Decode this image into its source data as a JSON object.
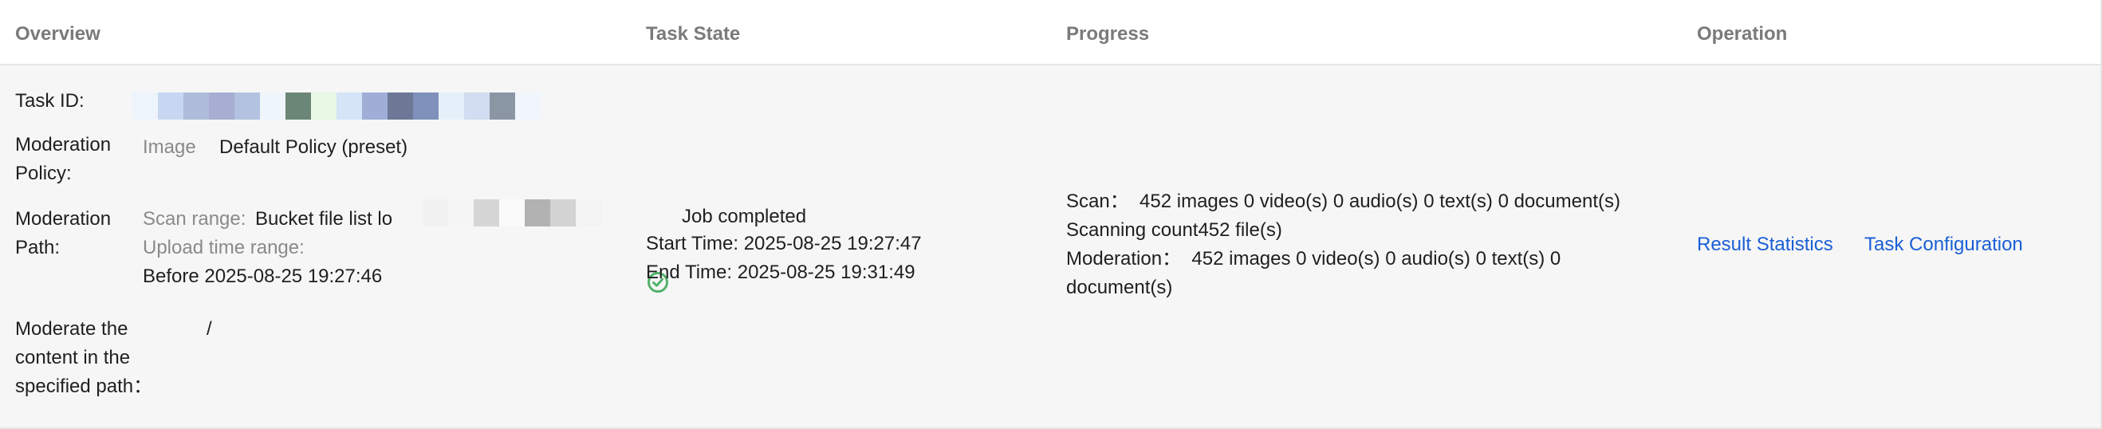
{
  "table": {
    "headers": {
      "overview": "Overview",
      "task_state": "Task State",
      "progress": "Progress",
      "operation": "Operation"
    },
    "row": {
      "overview": {
        "task_id_label": "Task ID:",
        "moderation_policy_label_line1": "Moderation",
        "moderation_policy_label_line2": "Policy:",
        "policy_type": "Image",
        "policy_name": "Default Policy (preset)",
        "moderation_path_label_line1": "Moderation",
        "moderation_path_label_line2": "Path:",
        "scan_range_label": "Scan range:",
        "scan_range_value": "Bucket file list lo",
        "upload_time_range_label": "Upload time range:",
        "upload_time_range_value": "Before 2025-08-25 19:27:46",
        "specified_path_label_line1": "Moderate the",
        "specified_path_label_line2": "content in the",
        "specified_path_label_line3": "specified path：",
        "specified_path_value": "/"
      },
      "task_state": {
        "status": "Job completed",
        "status_color": "#52b36b",
        "start_time": "Start Time: 2025-08-25 19:27:47",
        "end_time": "End Time: 2025-08-25 19:31:49"
      },
      "progress": {
        "scan_line": "Scan：  452 images 0 video(s) 0 audio(s) 0 text(s) 0 document(s)",
        "scanning_count_line": "Scanning count452 file(s)",
        "moderation_line1": "Moderation：  452 images 0 video(s) 0 audio(s) 0 text(s) 0",
        "moderation_line2": "document(s)"
      },
      "operation": {
        "result_statistics": "Result Statistics",
        "task_configuration": "Task Configuration",
        "link_color": "#1a5fd6"
      }
    }
  }
}
